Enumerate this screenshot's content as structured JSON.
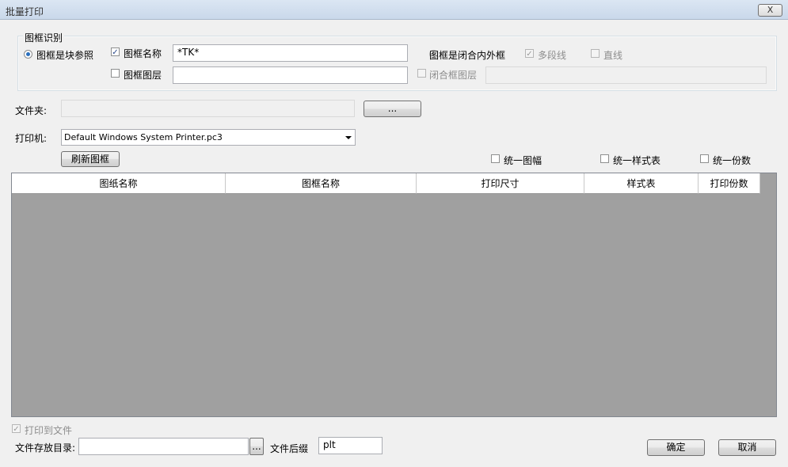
{
  "window": {
    "title": "批量打印",
    "close_label": "X"
  },
  "frame_recognition": {
    "group_title": "图框识别",
    "block_ref_label": "图框是块参照",
    "frame_name_label": "图框名称",
    "frame_name_value": "*TK*",
    "frame_layer_label": "图框图层",
    "frame_layer_value": "",
    "closed_frame_label": "图框是闭合内外框",
    "polyline_label": "多段线",
    "line_label": "直线",
    "closed_layer_label": "闭合框图层",
    "closed_layer_value": ""
  },
  "folder": {
    "label": "文件夹:",
    "value": "",
    "browse_label": "..."
  },
  "printer": {
    "label": "打印机:",
    "selected": "Default Windows System Printer.pc3"
  },
  "refresh_label": "刷新图框",
  "unify": {
    "size_label": "统一图幅",
    "style_label": "统一样式表",
    "copies_label": "统一份数"
  },
  "table": {
    "columns": [
      "图纸名称",
      "图框名称",
      "打印尺寸",
      "样式表",
      "打印份数"
    ]
  },
  "output": {
    "print_to_file_label": "打印到文件",
    "dir_label": "文件存放目录:",
    "dir_value": "",
    "dir_browse_label": "...",
    "suffix_label": "文件后缀",
    "suffix_value": "plt"
  },
  "buttons": {
    "ok_label": "确定",
    "cancel_label": "取消"
  },
  "checks": {
    "mark": "✓"
  }
}
